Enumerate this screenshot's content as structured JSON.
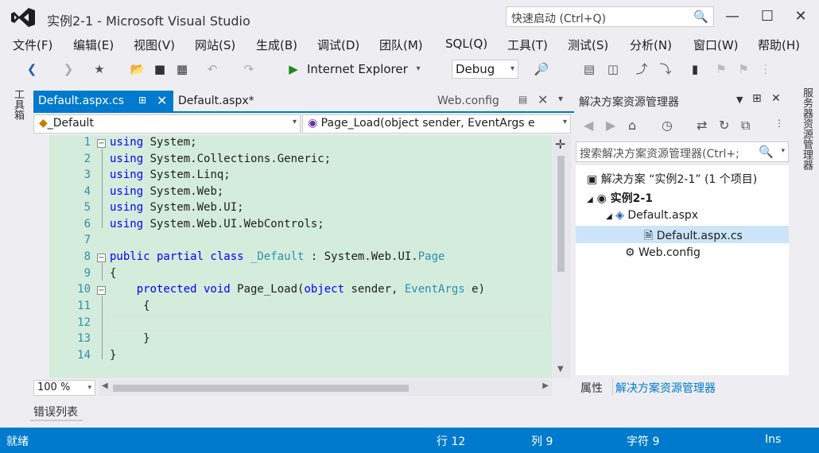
{
  "window": {
    "title": "实例2-1 - Microsoft Visual Studio",
    "quick_launch_placeholder": "快速启动 (Ctrl+Q)",
    "minimize": "—",
    "maximize": "☐",
    "close": "✕"
  },
  "menu": [
    "文件(F)",
    "编辑(E)",
    "视图(V)",
    "网站(S)",
    "生成(B)",
    "调试(D)",
    "团队(M)",
    "SQL(Q)",
    "工具(T)",
    "测试(S)",
    "分析(N)",
    "窗口(W)",
    "帮助(H)"
  ],
  "toolbar": {
    "run_target": "Internet Explorer",
    "configuration": "Debug"
  },
  "tabs": {
    "active": "Default.aspx.cs",
    "second": "Default.aspx*",
    "preview": "Web.config"
  },
  "side": {
    "toolbox": "工具箱",
    "server_explorer": "服务器资源管理器"
  },
  "navbar": {
    "class": "_Default",
    "member": "Page_Load(object sender, EventArgs e"
  },
  "editor": {
    "line_numbers": [
      "1",
      "2",
      "3",
      "4",
      "5",
      "6",
      "7",
      "8",
      "9",
      "10",
      "11",
      "12",
      "13",
      "14"
    ],
    "zoom": "100 %"
  },
  "code": {
    "l1_kw": "using",
    "l1_rest": " System;",
    "l2_kw": "using",
    "l2_rest": " System.Collections.Generic;",
    "l3_kw": "using",
    "l3_rest": " System.Linq;",
    "l4_kw": "using",
    "l4_rest": " System.Web;",
    "l5_kw": "using",
    "l5_rest": " System.Web.UI;",
    "l6_kw": "using",
    "l6_rest": " System.Web.UI.WebControls;",
    "l8_kw": "public partial class",
    "l8_ty": " _Default",
    "l8_mid": " : System.Web.UI.",
    "l8_ty2": "Page",
    "l9": "{",
    "l10_kw": "    protected void",
    "l10_mid": " Page_Load(",
    "l10_kw2": "object",
    "l10_mid2": " sender, ",
    "l10_ty": "EventArgs",
    "l10_end": " e)",
    "l11": "     {",
    "l12": "",
    "l13": "     }",
    "l14": "}"
  },
  "error_list": "错误列表",
  "solution_explorer": {
    "title": "解决方案资源管理器",
    "search_placeholder": "搜索解决方案资源管理器(Ctrl+;",
    "solution_node": "解决方案 “实例2-1” (1 个项目)",
    "project_node": "实例2-1",
    "file_aspx": "Default.aspx",
    "file_cs": "Default.aspx.cs",
    "file_config": "Web.config",
    "tab_properties": "属性",
    "tab_solution": "解决方案资源管理器"
  },
  "status": {
    "ready": "就绪",
    "line": "行 12",
    "col": "列 9",
    "ch": "字符 9",
    "mode": "Ins"
  },
  "colors": {
    "accent": "#007acc",
    "editor_bg": "#d4ecdc",
    "keyword": "#0000ff",
    "type": "#2b91af"
  }
}
